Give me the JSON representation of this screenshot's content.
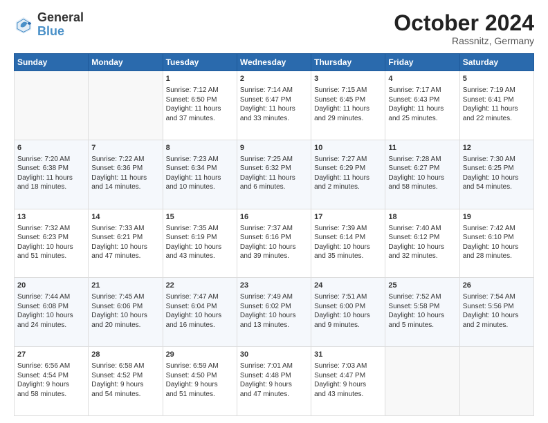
{
  "header": {
    "logo_line1": "General",
    "logo_line2": "Blue",
    "month": "October 2024",
    "location": "Rassnitz, Germany"
  },
  "weekdays": [
    "Sunday",
    "Monday",
    "Tuesday",
    "Wednesday",
    "Thursday",
    "Friday",
    "Saturday"
  ],
  "weeks": [
    [
      {
        "day": "",
        "info": ""
      },
      {
        "day": "",
        "info": ""
      },
      {
        "day": "1",
        "info": "Sunrise: 7:12 AM\nSunset: 6:50 PM\nDaylight: 11 hours\nand 37 minutes."
      },
      {
        "day": "2",
        "info": "Sunrise: 7:14 AM\nSunset: 6:47 PM\nDaylight: 11 hours\nand 33 minutes."
      },
      {
        "day": "3",
        "info": "Sunrise: 7:15 AM\nSunset: 6:45 PM\nDaylight: 11 hours\nand 29 minutes."
      },
      {
        "day": "4",
        "info": "Sunrise: 7:17 AM\nSunset: 6:43 PM\nDaylight: 11 hours\nand 25 minutes."
      },
      {
        "day": "5",
        "info": "Sunrise: 7:19 AM\nSunset: 6:41 PM\nDaylight: 11 hours\nand 22 minutes."
      }
    ],
    [
      {
        "day": "6",
        "info": "Sunrise: 7:20 AM\nSunset: 6:38 PM\nDaylight: 11 hours\nand 18 minutes."
      },
      {
        "day": "7",
        "info": "Sunrise: 7:22 AM\nSunset: 6:36 PM\nDaylight: 11 hours\nand 14 minutes."
      },
      {
        "day": "8",
        "info": "Sunrise: 7:23 AM\nSunset: 6:34 PM\nDaylight: 11 hours\nand 10 minutes."
      },
      {
        "day": "9",
        "info": "Sunrise: 7:25 AM\nSunset: 6:32 PM\nDaylight: 11 hours\nand 6 minutes."
      },
      {
        "day": "10",
        "info": "Sunrise: 7:27 AM\nSunset: 6:29 PM\nDaylight: 11 hours\nand 2 minutes."
      },
      {
        "day": "11",
        "info": "Sunrise: 7:28 AM\nSunset: 6:27 PM\nDaylight: 10 hours\nand 58 minutes."
      },
      {
        "day": "12",
        "info": "Sunrise: 7:30 AM\nSunset: 6:25 PM\nDaylight: 10 hours\nand 54 minutes."
      }
    ],
    [
      {
        "day": "13",
        "info": "Sunrise: 7:32 AM\nSunset: 6:23 PM\nDaylight: 10 hours\nand 51 minutes."
      },
      {
        "day": "14",
        "info": "Sunrise: 7:33 AM\nSunset: 6:21 PM\nDaylight: 10 hours\nand 47 minutes."
      },
      {
        "day": "15",
        "info": "Sunrise: 7:35 AM\nSunset: 6:19 PM\nDaylight: 10 hours\nand 43 minutes."
      },
      {
        "day": "16",
        "info": "Sunrise: 7:37 AM\nSunset: 6:16 PM\nDaylight: 10 hours\nand 39 minutes."
      },
      {
        "day": "17",
        "info": "Sunrise: 7:39 AM\nSunset: 6:14 PM\nDaylight: 10 hours\nand 35 minutes."
      },
      {
        "day": "18",
        "info": "Sunrise: 7:40 AM\nSunset: 6:12 PM\nDaylight: 10 hours\nand 32 minutes."
      },
      {
        "day": "19",
        "info": "Sunrise: 7:42 AM\nSunset: 6:10 PM\nDaylight: 10 hours\nand 28 minutes."
      }
    ],
    [
      {
        "day": "20",
        "info": "Sunrise: 7:44 AM\nSunset: 6:08 PM\nDaylight: 10 hours\nand 24 minutes."
      },
      {
        "day": "21",
        "info": "Sunrise: 7:45 AM\nSunset: 6:06 PM\nDaylight: 10 hours\nand 20 minutes."
      },
      {
        "day": "22",
        "info": "Sunrise: 7:47 AM\nSunset: 6:04 PM\nDaylight: 10 hours\nand 16 minutes."
      },
      {
        "day": "23",
        "info": "Sunrise: 7:49 AM\nSunset: 6:02 PM\nDaylight: 10 hours\nand 13 minutes."
      },
      {
        "day": "24",
        "info": "Sunrise: 7:51 AM\nSunset: 6:00 PM\nDaylight: 10 hours\nand 9 minutes."
      },
      {
        "day": "25",
        "info": "Sunrise: 7:52 AM\nSunset: 5:58 PM\nDaylight: 10 hours\nand 5 minutes."
      },
      {
        "day": "26",
        "info": "Sunrise: 7:54 AM\nSunset: 5:56 PM\nDaylight: 10 hours\nand 2 minutes."
      }
    ],
    [
      {
        "day": "27",
        "info": "Sunrise: 6:56 AM\nSunset: 4:54 PM\nDaylight: 9 hours\nand 58 minutes."
      },
      {
        "day": "28",
        "info": "Sunrise: 6:58 AM\nSunset: 4:52 PM\nDaylight: 9 hours\nand 54 minutes."
      },
      {
        "day": "29",
        "info": "Sunrise: 6:59 AM\nSunset: 4:50 PM\nDaylight: 9 hours\nand 51 minutes."
      },
      {
        "day": "30",
        "info": "Sunrise: 7:01 AM\nSunset: 4:48 PM\nDaylight: 9 hours\nand 47 minutes."
      },
      {
        "day": "31",
        "info": "Sunrise: 7:03 AM\nSunset: 4:47 PM\nDaylight: 9 hours\nand 43 minutes."
      },
      {
        "day": "",
        "info": ""
      },
      {
        "day": "",
        "info": ""
      }
    ]
  ]
}
